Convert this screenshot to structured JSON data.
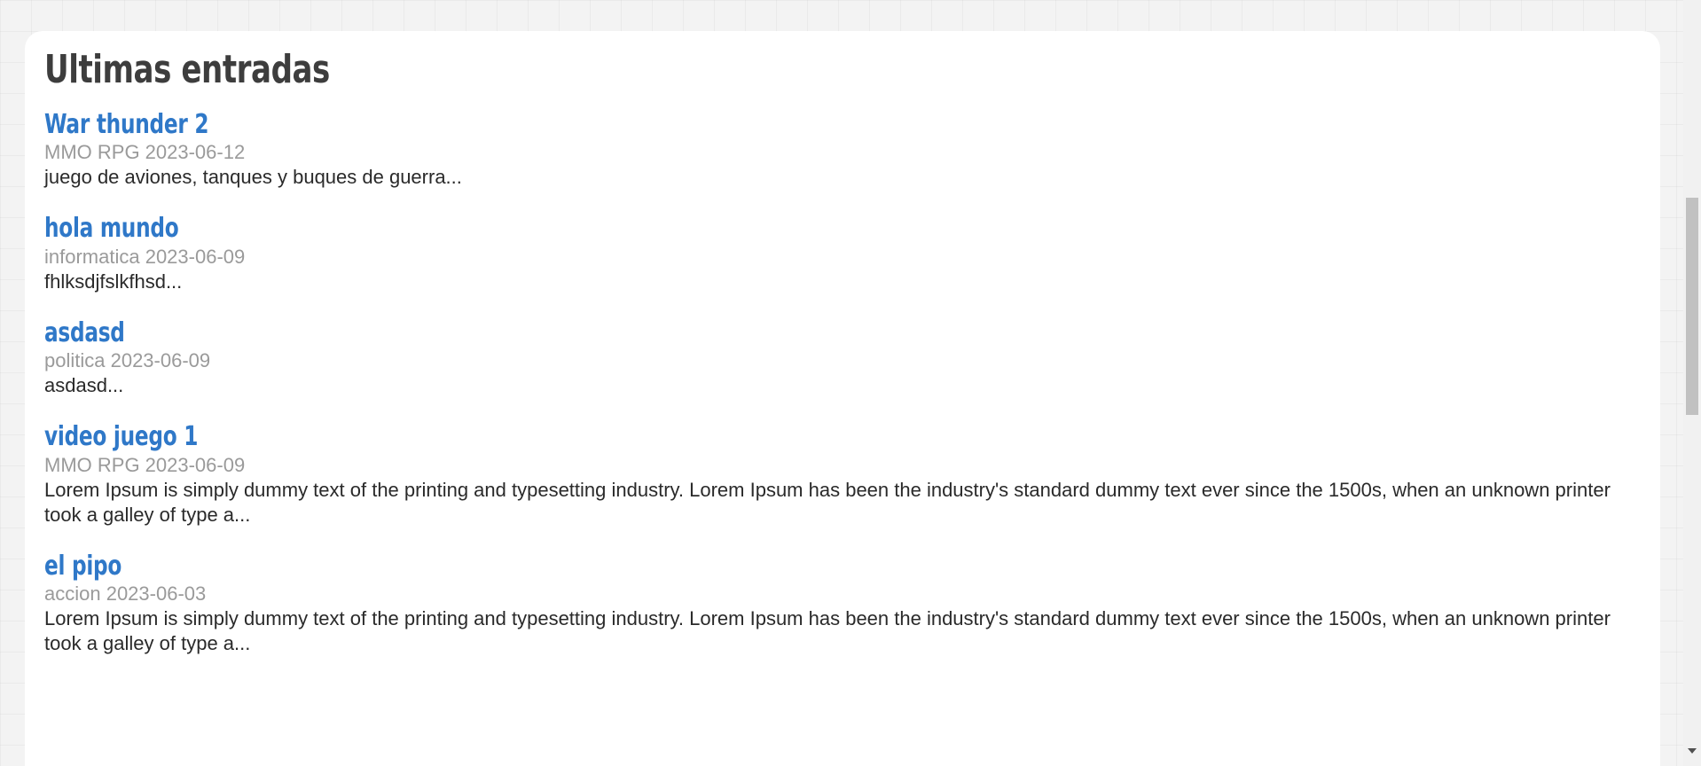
{
  "page": {
    "title": "Ultimas entradas"
  },
  "posts": [
    {
      "title": "War thunder 2",
      "meta": "MMO RPG 2023-06-12",
      "excerpt": "juego de aviones, tanques y buques de guerra..."
    },
    {
      "title": "hola mundo",
      "meta": "informatica 2023-06-09",
      "excerpt": "fhlksdjfslkfhsd..."
    },
    {
      "title": "asdasd",
      "meta": "politica 2023-06-09",
      "excerpt": "asdasd..."
    },
    {
      "title": "video juego 1",
      "meta": "MMO RPG 2023-06-09",
      "excerpt": "Lorem Ipsum is simply dummy text of the printing and typesetting industry. Lorem Ipsum has been the industry's standard dummy text ever since the 1500s, when an unknown printer took a galley of type a..."
    },
    {
      "title": "el pipo",
      "meta": "accion 2023-06-03",
      "excerpt": "Lorem Ipsum is simply dummy text of the printing and typesetting industry. Lorem Ipsum has been the industry's standard dummy text ever since the 1500s, when an unknown printer took a galley of type a..."
    }
  ],
  "colors": {
    "title": "#3d3d3d",
    "link": "#2f78c8",
    "meta": "#9a9a9a",
    "text": "#2a2a2a",
    "background": "#f3f3f3",
    "card": "#ffffff"
  },
  "icons": {
    "scroll_down": "chevron-down-icon"
  }
}
